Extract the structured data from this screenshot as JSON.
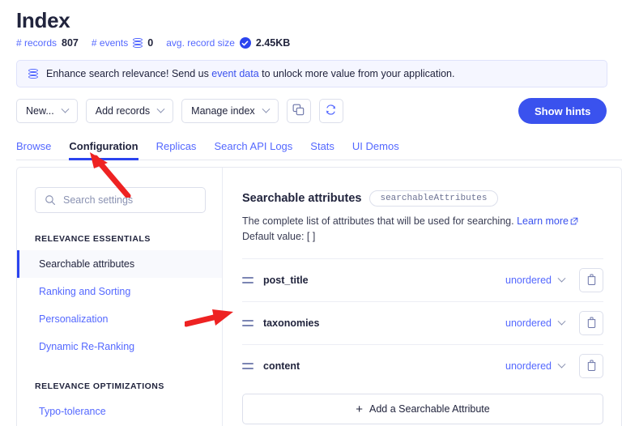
{
  "header": {
    "title": "Index",
    "stats": [
      {
        "label": "# records",
        "value": "807",
        "icon": ""
      },
      {
        "label": "# events",
        "value": "0",
        "icon": "database-icon"
      },
      {
        "label": "avg. record size",
        "value": "2.45KB",
        "icon": "check-circle-icon"
      }
    ]
  },
  "banner": {
    "icon": "database-icon",
    "text_before": "Enhance search relevance! Send us ",
    "link": "event data",
    "text_after": " to unlock more value from your application."
  },
  "toolbar": {
    "buttons": [
      {
        "label": "New...",
        "caret": true
      },
      {
        "label": "Add records",
        "caret": true
      },
      {
        "label": "Manage index",
        "caret": true
      }
    ],
    "copy_icon": "copy-icon",
    "refresh_icon": "refresh-icon",
    "show_hints_label": "Show hints",
    "avatar": "user-avatar"
  },
  "tabs": [
    {
      "label": "Browse",
      "active": false
    },
    {
      "label": "Configuration",
      "active": true
    },
    {
      "label": "Replicas",
      "active": false
    },
    {
      "label": "Search API Logs",
      "active": false
    },
    {
      "label": "Stats",
      "active": false
    },
    {
      "label": "UI Demos",
      "active": false
    }
  ],
  "sidebar": {
    "search_placeholder": "Search settings",
    "groups": [
      {
        "title": "RELEVANCE ESSENTIALS",
        "items": [
          {
            "label": "Searchable attributes",
            "active": true
          },
          {
            "label": "Ranking and Sorting",
            "active": false
          },
          {
            "label": "Personalization",
            "active": false
          },
          {
            "label": "Dynamic Re-Ranking",
            "active": false
          }
        ]
      },
      {
        "title": "RELEVANCE OPTIMIZATIONS",
        "items": [
          {
            "label": "Typo-tolerance",
            "active": false
          }
        ]
      }
    ]
  },
  "panel": {
    "title": "Searchable attributes",
    "code_pill": "searchableAttributes",
    "description": "The complete list of attributes that will be used for searching.",
    "learn_more": "Learn more",
    "default_value": "Default value: [ ]",
    "rows": [
      {
        "name": "post_title",
        "order": "unordered"
      },
      {
        "name": "taxonomies",
        "order": "unordered"
      },
      {
        "name": "content",
        "order": "unordered"
      }
    ],
    "add_label": "Add a Searchable Attribute"
  },
  "annotations": [
    {
      "name": "arrow-to-configuration-tab",
      "color": "#ee2222"
    },
    {
      "name": "arrow-to-taxonomies-row",
      "color": "#ee2222"
    }
  ],
  "colors": {
    "brand_blue": "#3a52ee",
    "link_blue": "#3a51ee",
    "muted_blue": "#5468ff",
    "text_dark": "#21243d",
    "annotation_red": "#ee2222"
  }
}
